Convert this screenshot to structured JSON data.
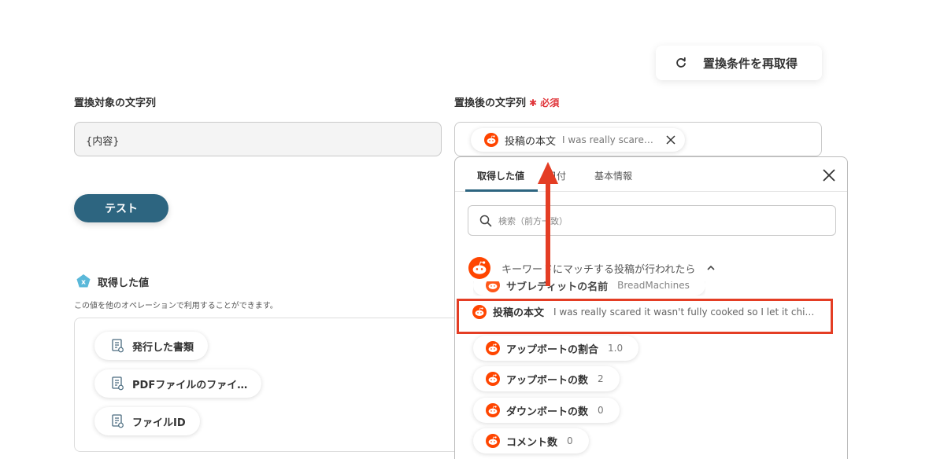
{
  "header": {
    "refresh_label": "置換条件を再取得"
  },
  "form": {
    "target_label": "置換対象の文字列",
    "target_value": "{内容}",
    "replace_label": "置換後の文字列",
    "required_mark": "✱ 必須",
    "chip_name": "投稿の本文",
    "chip_value": "I was really scare…"
  },
  "test_button": "テスト",
  "outputs": {
    "title": "取得した値",
    "description": "この値を他のオペレーションで利用することができます。",
    "items": [
      "発行した書類",
      "PDFファイルのファイ…",
      "ファイルID"
    ]
  },
  "dropdown": {
    "tabs": [
      "取得した値",
      "日付",
      "基本情報"
    ],
    "search_placeholder": "検索（前方一致）",
    "group_title": "キーワードにマッチする投稿が行われたら",
    "partial_item": "サブレディットの名前",
    "partial_value": "BreadMachines",
    "highlighted": {
      "name": "投稿の本文",
      "value": "I was really scared it wasn't fully cooked so I let it chi…"
    },
    "items": [
      {
        "name": "アップボートの割合",
        "value": "1.0"
      },
      {
        "name": "アップボートの数",
        "value": "2"
      },
      {
        "name": "ダウンボートの数",
        "value": "0"
      },
      {
        "name": "コメント数",
        "value": "0"
      }
    ]
  },
  "colors": {
    "accent": "#2d6580",
    "required": "#e0353a",
    "highlight": "#e43d24",
    "reddit": "#ff4500"
  }
}
